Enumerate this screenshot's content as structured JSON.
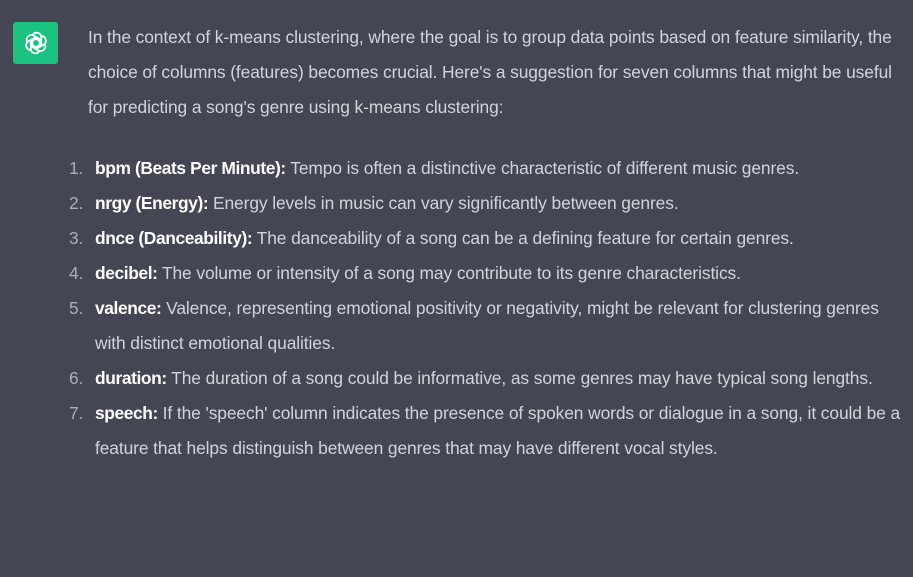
{
  "assistant": {
    "avatar_icon": "openai-logo-icon",
    "avatar_color": "#19c37d"
  },
  "message": {
    "intro": "In the context of k-means clustering, where the goal is to group data points based on feature similarity, the choice of columns (features) becomes crucial. Here's a suggestion for seven columns that might be useful for predicting a song's genre using k-means clustering:",
    "items": [
      {
        "number": "1.",
        "term": "bpm (Beats Per Minute):",
        "text": " Tempo is often a distinctive characteristic of different music genres."
      },
      {
        "number": "2.",
        "term": "nrgy (Energy):",
        "text": " Energy levels in music can vary significantly between genres."
      },
      {
        "number": "3.",
        "term": "dnce (Danceability):",
        "text": " The danceability of a song can be a defining feature for certain genres."
      },
      {
        "number": "4.",
        "term": "decibel:",
        "text": " The volume or intensity of a song may contribute to its genre characteristics."
      },
      {
        "number": "5.",
        "term": "valence:",
        "text": " Valence, representing emotional positivity or negativity, might be relevant for clustering genres with distinct emotional qualities."
      },
      {
        "number": "6.",
        "term": "duration:",
        "text": " The duration of a song could be informative, as some genres may have typical song lengths."
      },
      {
        "number": "7.",
        "term": "speech:",
        "text": " If the 'speech' column indicates the presence of spoken words or dialogue in a song, it could be a feature that helps distinguish between genres that may have different vocal styles."
      }
    ]
  }
}
